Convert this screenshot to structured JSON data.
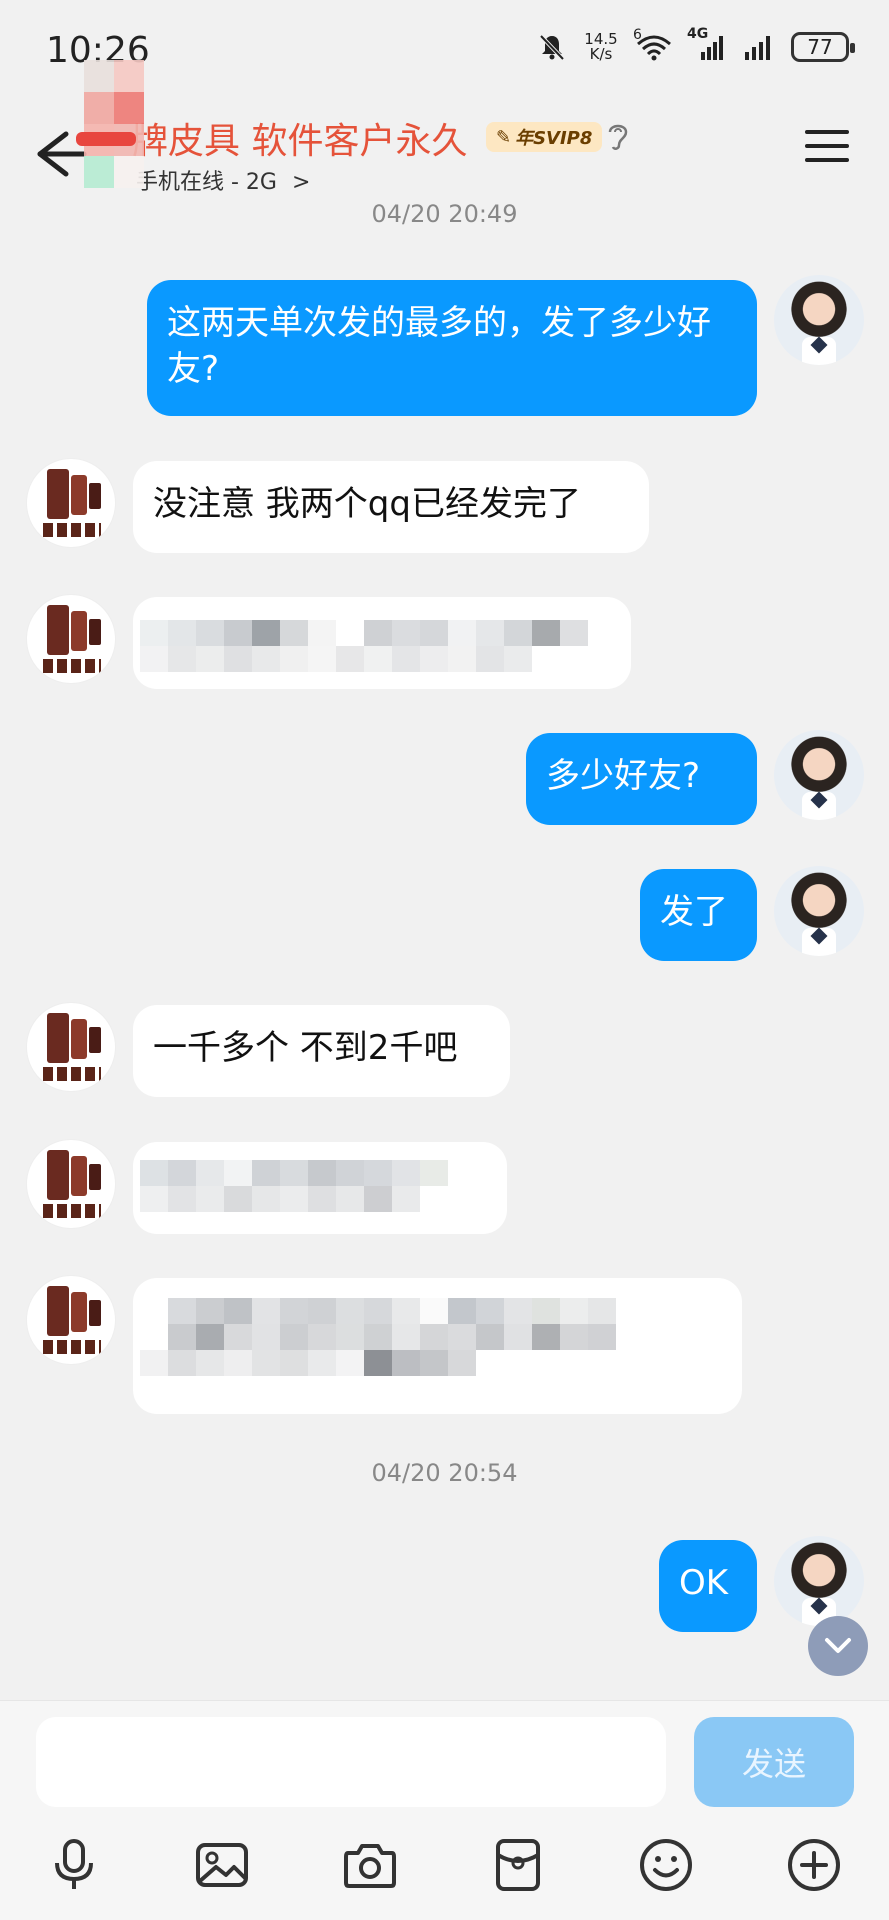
{
  "status_bar": {
    "time": "10:26",
    "net_speed_value": "14.5",
    "net_speed_unit": "K/s",
    "wifi_badge": "6",
    "cell_badge": "4G",
    "battery": "77"
  },
  "header": {
    "title": "牌皮具 软件客户永久",
    "svip": "年SVIP8",
    "subtitle": "手机在线 - 2G",
    "subtitle_arrow": ">"
  },
  "timestamps": [
    "04/20 20:49",
    "04/20 20:54"
  ],
  "messages": [
    {
      "side": "out",
      "text": "这两天单次发的最多的，发了多少好友?"
    },
    {
      "side": "in",
      "text": "没注意 我两个qq已经发完了"
    },
    {
      "side": "in",
      "text": "",
      "obscured": true
    },
    {
      "side": "out",
      "text": "多少好友?"
    },
    {
      "side": "out",
      "text": "发了"
    },
    {
      "side": "in",
      "text": "一千多个 不到2千吧"
    },
    {
      "side": "in",
      "text": "",
      "obscured": true
    },
    {
      "side": "in",
      "text": "",
      "obscured": true
    },
    {
      "side": "out",
      "text": "OK"
    }
  ],
  "input": {
    "value": "",
    "placeholder": "",
    "send_label": "发送"
  },
  "toolbar": [
    "microphone-icon",
    "image-icon",
    "camera-icon",
    "red-packet-icon",
    "emoji-icon",
    "plus-icon"
  ],
  "colors": {
    "accent": "#0a99ff",
    "title": "#e5533a",
    "background": "#f1f1f1",
    "send_disabled": "#8ac8f5"
  }
}
